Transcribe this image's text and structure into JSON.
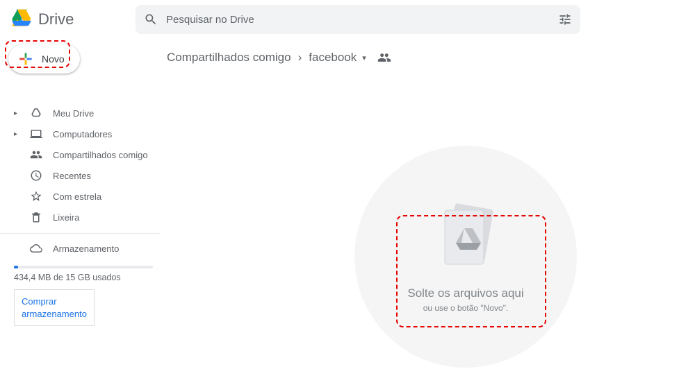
{
  "header": {
    "product_name": "Drive",
    "search_placeholder": "Pesquisar no Drive"
  },
  "sidebar": {
    "new_label": "Novo",
    "items": [
      {
        "label": "Meu Drive",
        "icon": "drive"
      },
      {
        "label": "Computadores",
        "icon": "computer"
      },
      {
        "label": "Compartilhados comigo",
        "icon": "shared"
      },
      {
        "label": "Recentes",
        "icon": "clock"
      },
      {
        "label": "Com estrela",
        "icon": "star"
      },
      {
        "label": "Lixeira",
        "icon": "trash"
      }
    ],
    "storage_label": "Armazenamento",
    "storage_text": "434,4 MB de 15 GB usados",
    "buy_line1": "Comprar",
    "buy_line2": "armazenamento"
  },
  "breadcrumb": {
    "parent": "Compartilhados comigo",
    "current": "facebook"
  },
  "dropzone": {
    "title": "Solte os arquivos aqui",
    "subtitle": "ou use o botão \"Novo\"."
  }
}
